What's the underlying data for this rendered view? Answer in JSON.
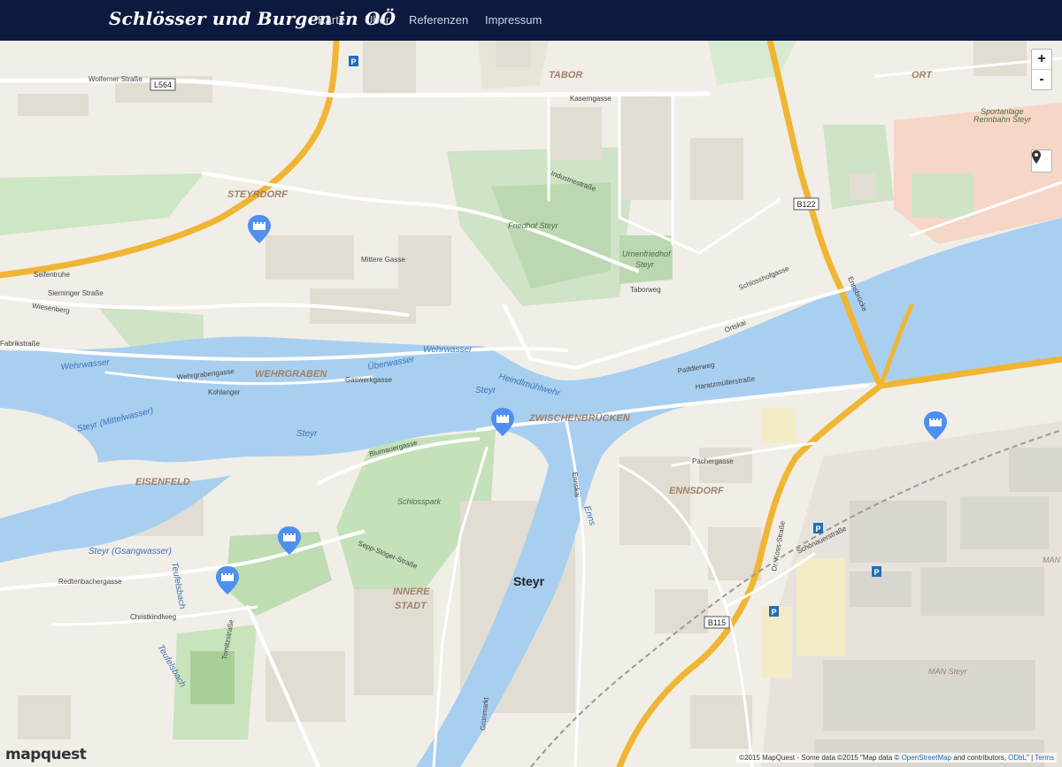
{
  "navbar": {
    "brand": "Schlösser und Burgen in OÖ",
    "links": [
      "Karte",
      "Über",
      "Referenzen",
      "Impressum"
    ]
  },
  "map_controls": {
    "zoom_in": "+",
    "zoom_out": "-"
  },
  "logo": "mapquest",
  "attribution": {
    "prefix": "©2015 MapQuest -  Some data ©2015 \"Map data © ",
    "osm_link": "OpenStreetMap",
    "middle": " and contributors, ",
    "odbl_link": "ODbL",
    "sep": "\" | ",
    "terms_link": "Terms"
  },
  "labels": {
    "tabor": "TABOR",
    "ort": "ORT",
    "steyrdorf": "STEYRDORF",
    "wehrgraben": "WEHRGRABEN",
    "eisenfeld": "EISENFELD",
    "zwischenbruecken": "ZWISCHENBRÜCKEN",
    "ennsdorf": "ENNSDORF",
    "innere": "INNERE",
    "stadt": "STADT",
    "steyr_city": "Steyr",
    "friedhof": "Friedhof Steyr",
    "urnenfriedhof1": "Urnenfriedhof",
    "urnenfriedhof2": "Steyr",
    "schlosspark": "Schlosspark",
    "wehrwasser1": "Wehrwasser",
    "wehrwasser2": "Wehrwasser",
    "ueberwasser": "Überwasser",
    "steyr_river1": "Steyr",
    "steyr_river2": "Steyr",
    "steyr_mittelwasser": "Steyr (Mittelwasser)",
    "steyr_gsangwasser": "Steyr (Gsangwasser)",
    "heindlmuehlwehr": "Heindlmühlwehr",
    "enns": "Enns",
    "teufelsbach1": "Teufelsbach",
    "teufelsbach2": "Teufelsbach",
    "sportanlage1": "Sportanlage",
    "sportanlage2": "Rennbahn Steyr",
    "man_steyr": "MAN Steyr",
    "man_ste": "MAN",
    "wolfernerstrasse": "Wolferner Straße",
    "kaserngasse": "Kaserngasse",
    "sierninger": "Sierninger Straße",
    "ennsbruecke": "Ennsbrücke",
    "ennskai": "Ennskai",
    "ortskai": "Ortskai",
    "schlosshofgasse": "Schlosshofgasse",
    "dr_koss": "Dr.-Koss-Straße",
    "pachergasse": "Pachergasse",
    "blumauergasse": "Blumauergasse",
    "redtenbachergasse": "Redtenbachergasse",
    "christkindlweg": "Christkindlweg",
    "fabrikstrasse": "Fabrikstraße",
    "wehrgrabengasse": "Wehrgrabengasse",
    "kohlanger": "Kohlanger",
    "gaswerkgasse": "Gaswerkgasse",
    "mittere_gasse": "Mittere Gasse",
    "industriestrasse": "Industriestraße",
    "haratzmuellerstrasse": "Haratzmüllerstraße",
    "paddlerweg": "Paddlerweg",
    "schoenauerstrasse": "Schönauerstraße",
    "wiesenberg": "Wiesenberg",
    "seifentruhe": "Seifentruhe",
    "taborweg": "Taborweg",
    "grunmarkt": "Grünmarkt",
    "tomitzstrasse": "Tomitzstraße",
    "sepp_stoeger": "Sepp-Stöger-Straße"
  },
  "road_shields": [
    "L564",
    "B122",
    "B115"
  ],
  "markers": [
    {
      "name": "castle-marker-steyrdorf"
    },
    {
      "name": "castle-marker-zwischenbruecken"
    },
    {
      "name": "castle-marker-schlosspark"
    },
    {
      "name": "castle-marker-lamberg"
    },
    {
      "name": "castle-marker-ennsdorf"
    }
  ]
}
